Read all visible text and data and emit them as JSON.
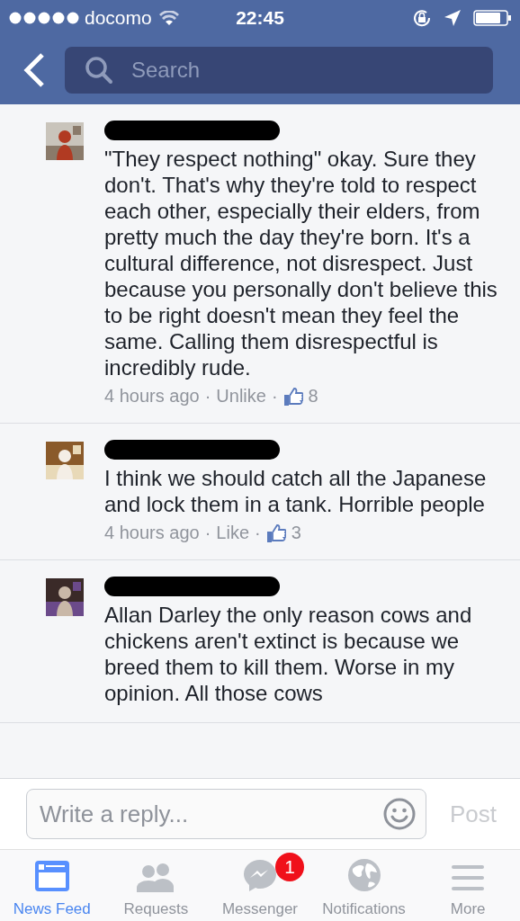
{
  "status_bar": {
    "carrier": "docomo",
    "time": "22:45"
  },
  "search": {
    "placeholder": "Search"
  },
  "comments": [
    {
      "text": "\"They respect nothing\" okay. Sure they don't. That's why they're told to respect each other, especially their elders, from pretty much the day they're born. It's a cultural difference, not disrespect. Just because you personally don't believe this to be right doesn't mean they feel the same. Calling them disrespectful is incredibly rude.",
      "time": "4 hours ago",
      "separator": "·",
      "action": "Unlike",
      "likes": "8"
    },
    {
      "text": "I think we should catch all the Japanese and lock them in a tank. Horrible people",
      "time": "4 hours ago",
      "separator": "·",
      "action": "Like",
      "likes": "3"
    },
    {
      "text": "Allan Darley the only reason cows and chickens aren't extinct is because we breed them to kill them. Worse in my opinion. All those cows"
    }
  ],
  "reply": {
    "placeholder": "Write a reply...",
    "post": "Post"
  },
  "tabs": [
    {
      "label": "News Feed",
      "selected": true,
      "kind": "feed"
    },
    {
      "label": "Requests",
      "selected": false,
      "kind": "requests"
    },
    {
      "label": "Messenger",
      "selected": false,
      "kind": "messenger",
      "badge": "1"
    },
    {
      "label": "Notifications",
      "selected": false,
      "kind": "globe"
    },
    {
      "label": "More",
      "selected": false,
      "kind": "more"
    }
  ]
}
